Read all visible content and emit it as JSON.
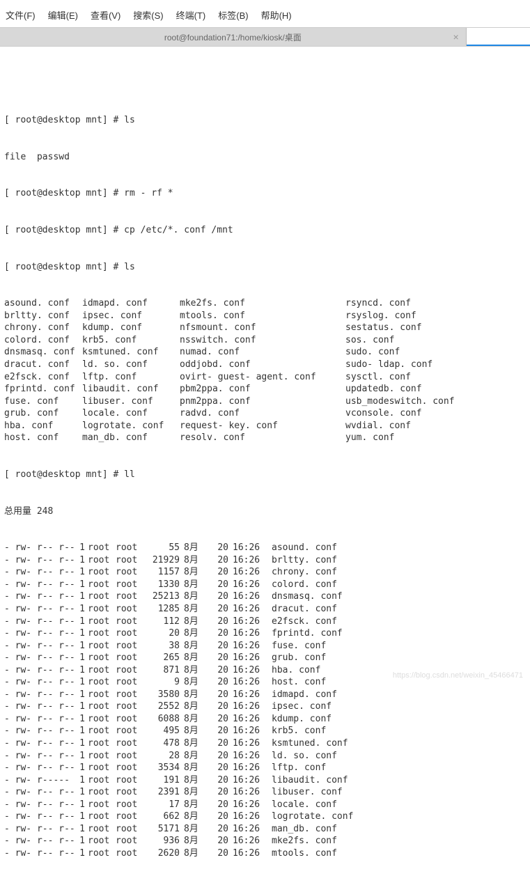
{
  "menu": {
    "items": [
      "文件(F)",
      "编辑(E)",
      "查看(V)",
      "搜索(S)",
      "终端(T)",
      "标签(B)",
      "帮助(H)"
    ]
  },
  "tab": {
    "title": "root@foundation71:/home/kiosk/桌面",
    "close": "×"
  },
  "prompts": {
    "p1": "[ root@desktop mnt] # ls",
    "p1_out": "file  passwd",
    "p2": "[ root@desktop mnt] # rm - rf *",
    "p3": "[ root@desktop mnt] # cp /etc/*. conf /mnt",
    "p4": "[ root@desktop mnt] # ls",
    "p5": "[ root@desktop mnt] # ll",
    "total": "总用量 248"
  },
  "ls": [
    [
      "asound. conf",
      "idmapd. conf",
      "mke2fs. conf",
      "rsyncd. conf"
    ],
    [
      "brltty. conf",
      "ipsec. conf",
      "mtools. conf",
      "rsyslog. conf"
    ],
    [
      "chrony. conf",
      "kdump. conf",
      "nfsmount. conf",
      "sestatus. conf"
    ],
    [
      "colord. conf",
      "krb5. conf",
      "nsswitch. conf",
      "sos. conf"
    ],
    [
      "dnsmasq. conf",
      "ksmtuned. conf",
      "numad. conf",
      "sudo. conf"
    ],
    [
      "dracut. conf",
      "ld. so. conf",
      "oddjobd. conf",
      "sudo- ldap. conf"
    ],
    [
      "e2fsck. conf",
      "lftp. conf",
      "ovirt- guest- agent. conf",
      "sysctl. conf"
    ],
    [
      "fprintd. conf",
      "libaudit. conf",
      "pbm2ppa. conf",
      "updatedb. conf"
    ],
    [
      "fuse. conf",
      "libuser. conf",
      "pnm2ppa. conf",
      "usb_modeswitch. conf"
    ],
    [
      "grub. conf",
      "locale. conf",
      "radvd. conf",
      "vconsole. conf"
    ],
    [
      "hba. conf",
      "logrotate. conf",
      "request- key. conf",
      "wvdial. conf"
    ],
    [
      "host. conf",
      "man_db. conf",
      "resolv. conf",
      "yum. conf"
    ]
  ],
  "ll": [
    {
      "perm": "- rw- r-- r--",
      "links": "1",
      "own1": "root",
      "own2": "root",
      "size": "55",
      "mon": "8月",
      "day": "20",
      "time": "16:26",
      "name": "asound. conf"
    },
    {
      "perm": "- rw- r-- r--",
      "links": "1",
      "own1": "root",
      "own2": "root",
      "size": "21929",
      "mon": "8月",
      "day": "20",
      "time": "16:26",
      "name": "brltty. conf"
    },
    {
      "perm": "- rw- r-- r--",
      "links": "1",
      "own1": "root",
      "own2": "root",
      "size": "1157",
      "mon": "8月",
      "day": "20",
      "time": "16:26",
      "name": "chrony. conf"
    },
    {
      "perm": "- rw- r-- r--",
      "links": "1",
      "own1": "root",
      "own2": "root",
      "size": "1330",
      "mon": "8月",
      "day": "20",
      "time": "16:26",
      "name": "colord. conf"
    },
    {
      "perm": "- rw- r-- r--",
      "links": "1",
      "own1": "root",
      "own2": "root",
      "size": "25213",
      "mon": "8月",
      "day": "20",
      "time": "16:26",
      "name": "dnsmasq. conf"
    },
    {
      "perm": "- rw- r-- r--",
      "links": "1",
      "own1": "root",
      "own2": "root",
      "size": "1285",
      "mon": "8月",
      "day": "20",
      "time": "16:26",
      "name": "dracut. conf"
    },
    {
      "perm": "- rw- r-- r--",
      "links": "1",
      "own1": "root",
      "own2": "root",
      "size": "112",
      "mon": "8月",
      "day": "20",
      "time": "16:26",
      "name": "e2fsck. conf"
    },
    {
      "perm": "- rw- r-- r--",
      "links": "1",
      "own1": "root",
      "own2": "root",
      "size": "20",
      "mon": "8月",
      "day": "20",
      "time": "16:26",
      "name": "fprintd. conf"
    },
    {
      "perm": "- rw- r-- r--",
      "links": "1",
      "own1": "root",
      "own2": "root",
      "size": "38",
      "mon": "8月",
      "day": "20",
      "time": "16:26",
      "name": "fuse. conf"
    },
    {
      "perm": "- rw- r-- r--",
      "links": "1",
      "own1": "root",
      "own2": "root",
      "size": "265",
      "mon": "8月",
      "day": "20",
      "time": "16:26",
      "name": "grub. conf"
    },
    {
      "perm": "- rw- r-- r--",
      "links": "1",
      "own1": "root",
      "own2": "root",
      "size": "871",
      "mon": "8月",
      "day": "20",
      "time": "16:26",
      "name": "hba. conf"
    },
    {
      "perm": "- rw- r-- r--",
      "links": "1",
      "own1": "root",
      "own2": "root",
      "size": "9",
      "mon": "8月",
      "day": "20",
      "time": "16:26",
      "name": "host. conf"
    },
    {
      "perm": "- rw- r-- r--",
      "links": "1",
      "own1": "root",
      "own2": "root",
      "size": "3580",
      "mon": "8月",
      "day": "20",
      "time": "16:26",
      "name": "idmapd. conf"
    },
    {
      "perm": "- rw- r-- r--",
      "links": "1",
      "own1": "root",
      "own2": "root",
      "size": "2552",
      "mon": "8月",
      "day": "20",
      "time": "16:26",
      "name": "ipsec. conf"
    },
    {
      "perm": "- rw- r-- r--",
      "links": "1",
      "own1": "root",
      "own2": "root",
      "size": "6088",
      "mon": "8月",
      "day": "20",
      "time": "16:26",
      "name": "kdump. conf"
    },
    {
      "perm": "- rw- r-- r--",
      "links": "1",
      "own1": "root",
      "own2": "root",
      "size": "495",
      "mon": "8月",
      "day": "20",
      "time": "16:26",
      "name": "krb5. conf"
    },
    {
      "perm": "- rw- r-- r--",
      "links": "1",
      "own1": "root",
      "own2": "root",
      "size": "478",
      "mon": "8月",
      "day": "20",
      "time": "16:26",
      "name": "ksmtuned. conf"
    },
    {
      "perm": "- rw- r-- r--",
      "links": "1",
      "own1": "root",
      "own2": "root",
      "size": "28",
      "mon": "8月",
      "day": "20",
      "time": "16:26",
      "name": "ld. so. conf"
    },
    {
      "perm": "- rw- r-- r--",
      "links": "1",
      "own1": "root",
      "own2": "root",
      "size": "3534",
      "mon": "8月",
      "day": "20",
      "time": "16:26",
      "name": "lftp. conf"
    },
    {
      "perm": "- rw- r-----",
      "links": "1",
      "own1": "root",
      "own2": "root",
      "size": "191",
      "mon": "8月",
      "day": "20",
      "time": "16:26",
      "name": "libaudit. conf"
    },
    {
      "perm": "- rw- r-- r--",
      "links": "1",
      "own1": "root",
      "own2": "root",
      "size": "2391",
      "mon": "8月",
      "day": "20",
      "time": "16:26",
      "name": "libuser. conf"
    },
    {
      "perm": "- rw- r-- r--",
      "links": "1",
      "own1": "root",
      "own2": "root",
      "size": "17",
      "mon": "8月",
      "day": "20",
      "time": "16:26",
      "name": "locale. conf"
    },
    {
      "perm": "- rw- r-- r--",
      "links": "1",
      "own1": "root",
      "own2": "root",
      "size": "662",
      "mon": "8月",
      "day": "20",
      "time": "16:26",
      "name": "logrotate. conf"
    },
    {
      "perm": "- rw- r-- r--",
      "links": "1",
      "own1": "root",
      "own2": "root",
      "size": "5171",
      "mon": "8月",
      "day": "20",
      "time": "16:26",
      "name": "man_db. conf"
    },
    {
      "perm": "- rw- r-- r--",
      "links": "1",
      "own1": "root",
      "own2": "root",
      "size": "936",
      "mon": "8月",
      "day": "20",
      "time": "16:26",
      "name": "mke2fs. conf"
    },
    {
      "perm": "- rw- r-- r--",
      "links": "1",
      "own1": "root",
      "own2": "root",
      "size": "2620",
      "mon": "8月",
      "day": "20",
      "time": "16:26",
      "name": "mtools. conf"
    }
  ],
  "watermark": "https://blog.csdn.net/weixin_45466471"
}
